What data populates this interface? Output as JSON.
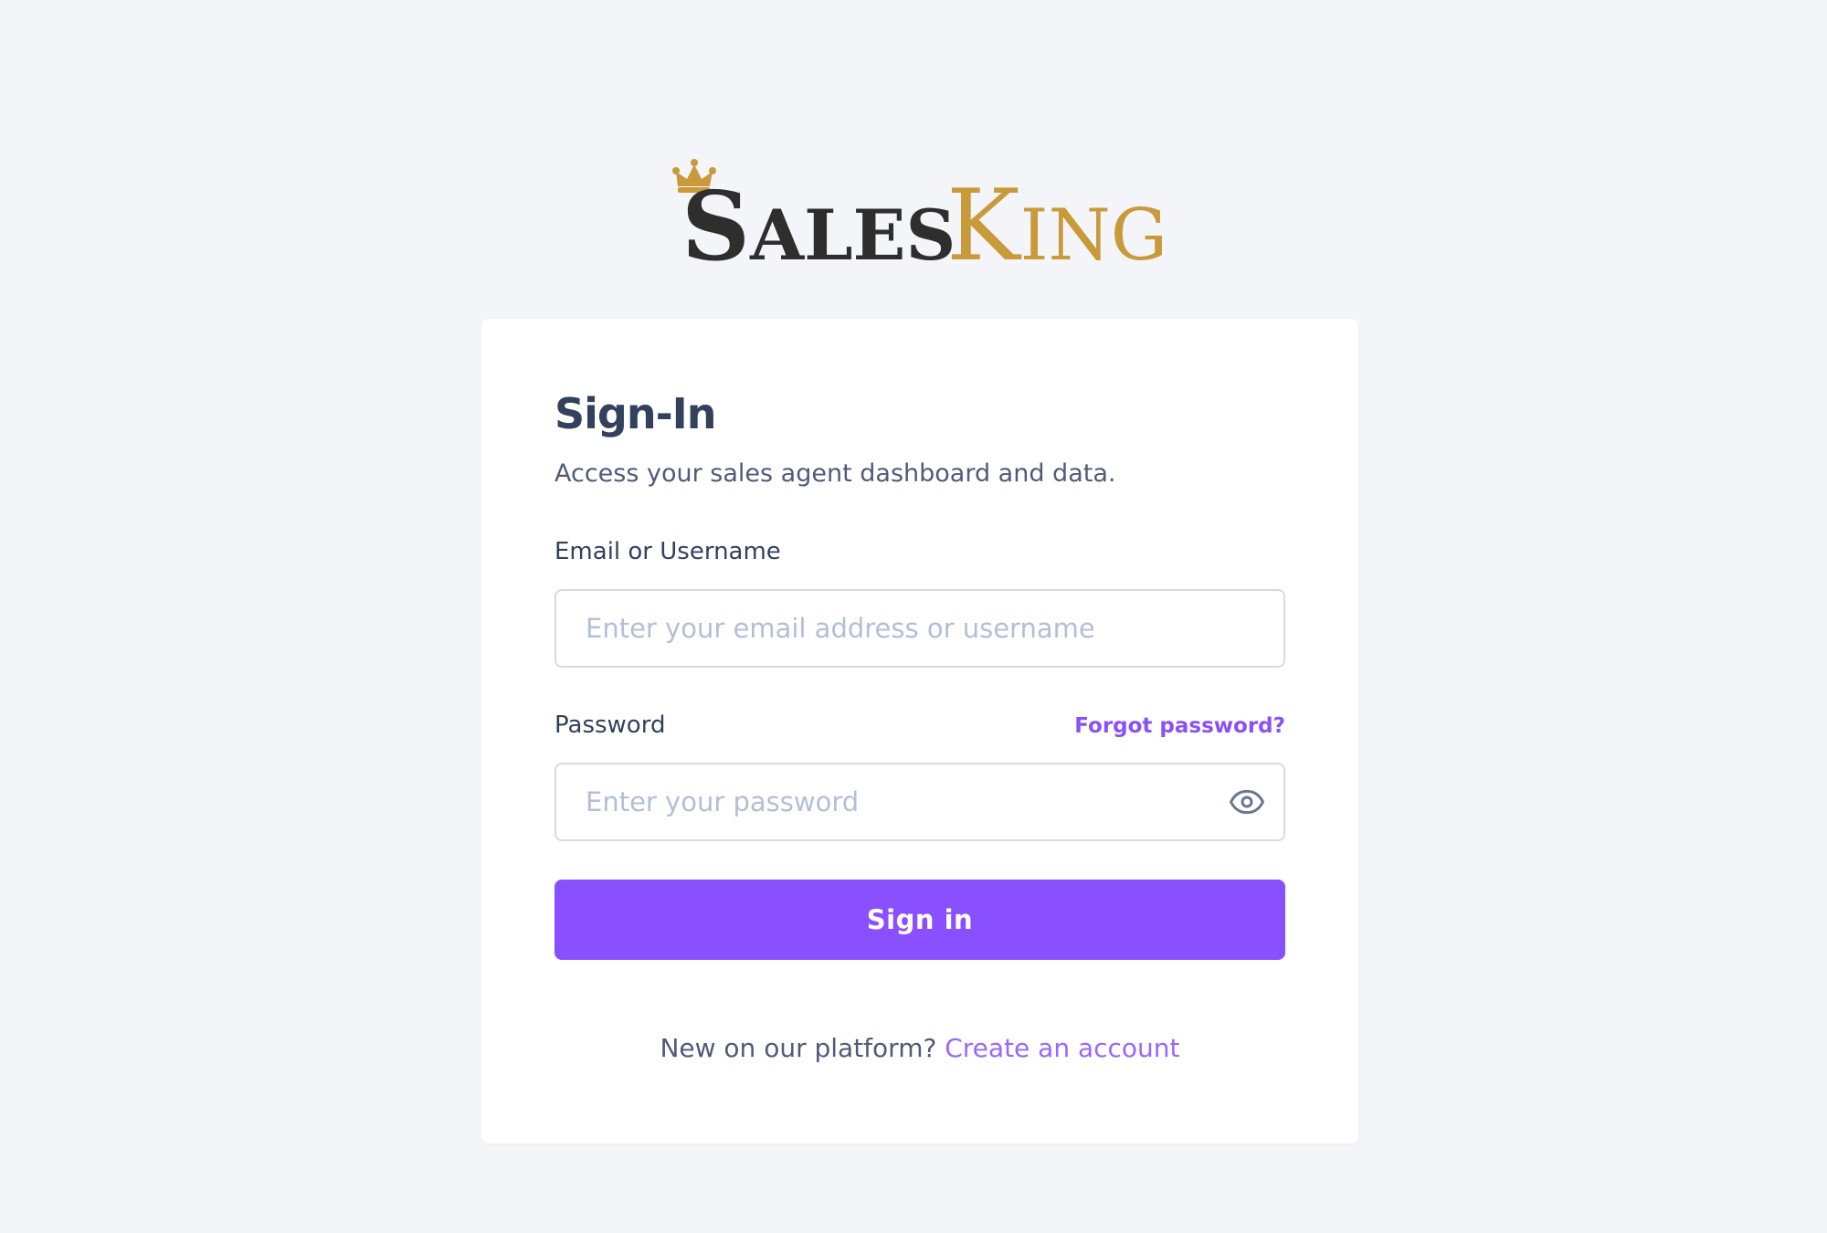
{
  "brand": {
    "logo_text_dark": "SALES",
    "logo_text_gold": "KING",
    "dark_color": "#2e2e2e",
    "gold_color": "#c99a3a",
    "crown_icon": "crown-icon"
  },
  "colors": {
    "accent": "#8a50ff",
    "link": "#8a50fa",
    "background": "#f4f5f9",
    "heading": "#33415c"
  },
  "signin": {
    "title": "Sign-In",
    "subtitle": "Access your sales agent dashboard and data.",
    "email": {
      "label": "Email or Username",
      "value": "",
      "placeholder": "Enter your email address or username"
    },
    "password": {
      "label": "Password",
      "value": "",
      "placeholder": "Enter your password",
      "toggle_icon": "eye-icon"
    },
    "forgot_link": "Forgot password?",
    "submit_label": "Sign in",
    "footer_prompt": "New on our platform?",
    "footer_link": "Create an account"
  }
}
